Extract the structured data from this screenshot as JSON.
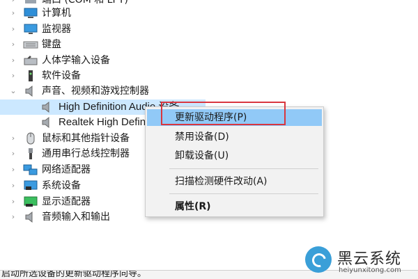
{
  "tree": {
    "top_partial_label": "端口 (COM 和 LPT)",
    "items": [
      {
        "label": "计算机",
        "icon": "computer-icon",
        "expanded": false
      },
      {
        "label": "监视器",
        "icon": "monitor-icon",
        "expanded": false
      },
      {
        "label": "键盘",
        "icon": "keyboard-icon",
        "expanded": false
      },
      {
        "label": "人体学输入设备",
        "icon": "hid-icon",
        "expanded": false
      },
      {
        "label": "软件设备",
        "icon": "software-device-icon",
        "expanded": false
      },
      {
        "label": "声音、视频和游戏控制器",
        "icon": "speaker-icon",
        "expanded": true,
        "children": [
          {
            "label": "High Definition Audio 设备",
            "icon": "speaker-icon",
            "selected": true
          },
          {
            "label": "Realtek High Definition Audio",
            "icon": "speaker-icon",
            "selected": false
          }
        ]
      },
      {
        "label": "鼠标和其他指针设备",
        "icon": "mouse-icon",
        "expanded": false
      },
      {
        "label": "通用串行总线控制器",
        "icon": "usb-icon",
        "expanded": false
      },
      {
        "label": "网络适配器",
        "icon": "network-icon",
        "expanded": false
      },
      {
        "label": "系统设备",
        "icon": "system-icon",
        "expanded": false
      },
      {
        "label": "显示适配器",
        "icon": "display-adapter-icon",
        "expanded": false
      },
      {
        "label": "音频输入和输出",
        "icon": "speaker-icon",
        "expanded": false
      }
    ]
  },
  "context_menu": {
    "items": [
      {
        "label": "更新驱动程序(P)",
        "highlighted": true
      },
      {
        "label": "禁用设备(D)"
      },
      {
        "label": "卸载设备(U)"
      },
      {
        "label": "扫描检测硬件改动(A)"
      },
      {
        "label": "属性(R)",
        "bold": true
      }
    ]
  },
  "status_bar": {
    "text": "启动所选设备的更新驱动程序向导。"
  },
  "watermark": {
    "title": "黑云系统",
    "subtitle": "heiyunxitong.com"
  },
  "colors": {
    "menu_highlight": "#91c9f7",
    "annotation_box": "#d9363e",
    "selection": "#cce8ff"
  }
}
